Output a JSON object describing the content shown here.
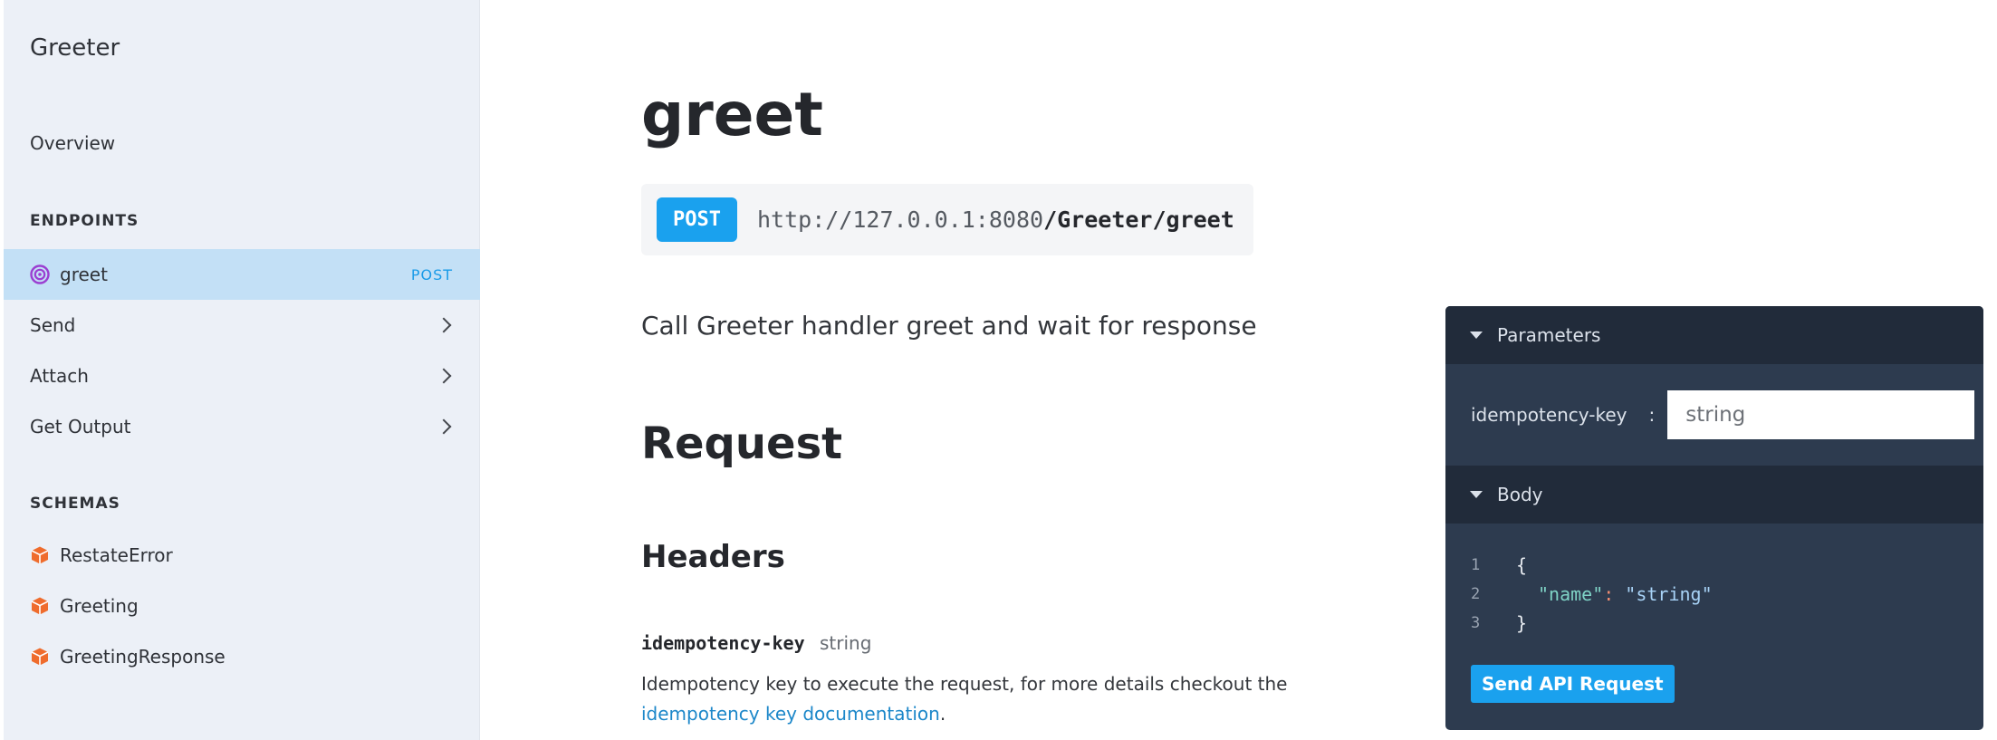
{
  "app": {
    "title": "Greeter"
  },
  "sidebar": {
    "overview_label": "Overview",
    "endpoints_heading": "ENDPOINTS",
    "endpoints": [
      {
        "label": "greet",
        "method": "POST",
        "icon": "target-icon",
        "active": true
      },
      {
        "label": "Send",
        "icon": "chevron-right-icon"
      },
      {
        "label": "Attach",
        "icon": "chevron-right-icon"
      },
      {
        "label": "Get Output",
        "icon": "chevron-right-icon"
      }
    ],
    "schemas_heading": "SCHEMAS",
    "schemas": [
      {
        "label": "RestateError",
        "icon": "cube-icon"
      },
      {
        "label": "Greeting",
        "icon": "cube-icon"
      },
      {
        "label": "GreetingResponse",
        "icon": "cube-icon"
      }
    ]
  },
  "main": {
    "title": "greet",
    "method": "POST",
    "url_base": "http://127.0.0.1:8080",
    "url_path": "/Greeter/greet",
    "description": "Call Greeter handler greet and wait for response",
    "request_heading": "Request",
    "headers_heading": "Headers",
    "header_param": {
      "name": "idempotency-key",
      "type": "string",
      "description": "Idempotency key to execute the request, for more details checkout the",
      "link_text": "idempotency key documentation",
      "trailing": "."
    }
  },
  "api_panel": {
    "parameters_label": "Parameters",
    "param_label": "idempotency-key",
    "param_colon": ":",
    "param_placeholder": "string",
    "body_label": "Body",
    "code_lines": [
      {
        "num": "1",
        "text": "{"
      },
      {
        "num": "2",
        "key": "\"name\"",
        "colon": ":",
        "value": "\"string\""
      },
      {
        "num": "3",
        "text": "}"
      }
    ],
    "send_label": "Send API Request"
  },
  "colors": {
    "accent": "#1aa1ee",
    "sidebar_bg": "#ecf0f7",
    "active_item_bg": "#c3e0f6",
    "schema_icon": "#ef6c2d",
    "target_icon": "#9b3fd1",
    "panel_bg": "#2d3b4f",
    "panel_header_bg": "#212b3a"
  }
}
